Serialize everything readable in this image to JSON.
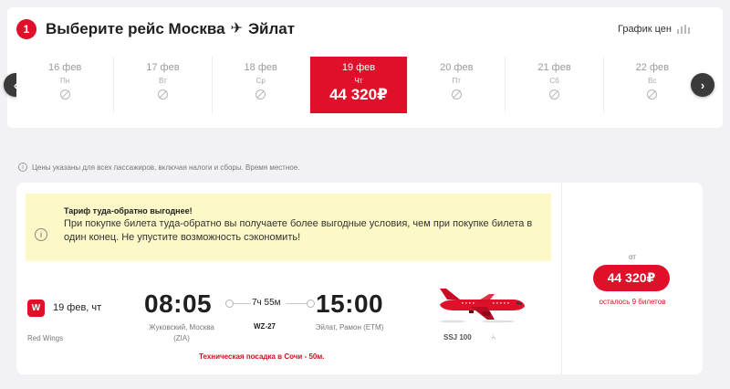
{
  "header": {
    "step_number": "1",
    "title_prefix": "Выберите рейс Москва",
    "title_plane_icon": "airplane-icon",
    "title_suffix": "Эйлат",
    "price_graph_label": "График цен"
  },
  "dates": [
    {
      "date": "16 фев",
      "weekday": "Пн",
      "price": null
    },
    {
      "date": "17 фев",
      "weekday": "Вт",
      "price": null
    },
    {
      "date": "18 фев",
      "weekday": "Ср",
      "price": null
    },
    {
      "date": "19 фев",
      "weekday": "Чт",
      "price": "44 320₽",
      "selected": true
    },
    {
      "date": "20 фев",
      "weekday": "Пт",
      "price": null
    },
    {
      "date": "21 фев",
      "weekday": "Сб",
      "price": null
    },
    {
      "date": "22 фев",
      "weekday": "Вс",
      "price": null
    }
  ],
  "info_note": "Цены указаны для всех пассажиров, включая налоги и сборы. Время местное.",
  "promo": {
    "title": "Тариф туда-обратно выгоднее!",
    "text": "При покупке билета туда-обратно вы получаете более выгодные условия, чем при покупке билета в один конец. Не упустите возможность сэкономить!"
  },
  "flight": {
    "date": "19 фев, чт",
    "airline": "Red Wings",
    "departure_time": "08:05",
    "departure_airport_line1": "Жуковский, Москва",
    "departure_airport_line2": "(ZIA)",
    "duration": "7ч 55м",
    "flight_number": "WZ-27",
    "arrival_time": "15:00",
    "arrival_airport": "Эйлат, Рамон (ETM)",
    "aircraft_model": "SSJ 100",
    "tech_stop": "Техническая посадка в Сочи - 50м."
  },
  "price_panel": {
    "from_label": "от",
    "price": "44 320₽",
    "tickets_left": "осталось 9 билетов"
  },
  "colors": {
    "brand_red": "#e0102a",
    "promo_bg": "#fcf8c8"
  }
}
